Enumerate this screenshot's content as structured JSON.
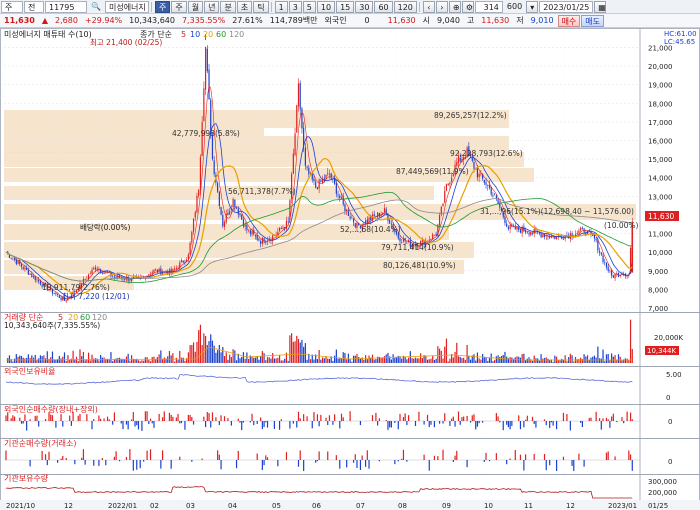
{
  "toolbar_row1": {
    "market_select": "주",
    "period_select": "전",
    "code_input": "11795",
    "stock_name": "미성에너지",
    "period_buttons": [
      "주",
      "주",
      "월",
      "년",
      "분",
      "초",
      "틱"
    ],
    "minute_buttons": [
      "1",
      "3",
      "5",
      "10",
      "15",
      "30",
      "60",
      "120"
    ],
    "count_input": "314",
    "total_count": "600",
    "date_input": "2023/01/25"
  },
  "quote_row": {
    "price": "11,630",
    "change": "2,680",
    "change_pct": "+29.94%",
    "volume": "10,343,640",
    "volume_pct": "7,335.55%",
    "turnover": "27.61%",
    "amount": "114,789백만",
    "ref_label": "외국인",
    "ref_value": "0",
    "last": "11,630",
    "open_label": "시",
    "open": "9,040",
    "high_label": "고",
    "high": "11,630",
    "low_label": "저",
    "low": "9,010",
    "buy_btn": "매수",
    "sell_btn": "매도"
  },
  "price_panel": {
    "title": "미성에너지 매튜태 수(10)",
    "ma_legend": [
      "종가 단순",
      "5",
      "10",
      "20",
      "60",
      "120"
    ],
    "hc_label": "HC:61.00",
    "lc_label": "LC:45.65",
    "current_price_tag": "11,630",
    "y_ticks": [
      "21,000",
      "20,000",
      "19,000",
      "18,000",
      "17,000",
      "16,000",
      "15,000",
      "14,000",
      "13,000",
      "12,000",
      "11,000",
      "10,000",
      "9,000",
      "8,000",
      "7,000"
    ],
    "annotations": {
      "high_mark": "최고 21,400 (02/25)",
      "low_mark": "최저 7,220 (12/01)",
      "vol1": "42,779,998(5.8%)",
      "vol2": "56,711,378(7.7%)",
      "vol3": "89,265,257(12.2%)",
      "vol4": "92,228,793(12.6%)",
      "vol5": "87,449,569(11.9%)",
      "vol6": "31,...,96(15.1%)(12,698,40 ~ 11,576.00)",
      "vol7": "52,...,68(10.4%)",
      "vol8": "79,711,414(10.9%)",
      "vol9": "80,126,481(10.9%)",
      "vol10": "(10.00%)",
      "left_low": "19,911,79(2.76%)",
      "event": "배당락(0.00%)"
    }
  },
  "volume_panel": {
    "title": "거래량 단순",
    "ma_legend": [
      "5",
      "20",
      "60",
      "120"
    ],
    "value_label": "10,343,640주(7,335.55%)",
    "y_tick": "20,000K",
    "current_tag": "10,344K"
  },
  "sub_panels": [
    {
      "title": "외국인보유비율",
      "y_tick": "5.00",
      "zero": "0"
    },
    {
      "title": "외국인순매수량(장내+장외)",
      "zero": "0"
    },
    {
      "title": "기관순매수량(거래소)",
      "zero": "0"
    },
    {
      "title": "기관보유수량",
      "y_ticks": [
        "300,000",
        "200,000"
      ]
    }
  ],
  "x_axis": [
    "2021/10",
    "12",
    "2022/01",
    "02",
    "03",
    "04",
    "05",
    "06",
    "07",
    "08",
    "09",
    "10",
    "11",
    "12",
    "2023/01",
    "01/25"
  ],
  "colors": {
    "candle_up": "#e02020",
    "candle_down": "#1a40d0",
    "ma5": "#e02020",
    "ma10": "#1a40d0",
    "ma20": "#e8a000",
    "ma60": "#1a9a30",
    "ma120": "#8a8a8a",
    "band": "#f6dfc4"
  },
  "chart_data": {
    "type": "candlestick",
    "x_range": [
      "2021/10",
      "2023/01/25"
    ],
    "y_range": [
      7000,
      21400
    ],
    "key_points": [
      {
        "date": "2021/10",
        "close": 10000
      },
      {
        "date": "2021/12/01",
        "low": 7220
      },
      {
        "date": "2022/01",
        "close": 8500
      },
      {
        "date": "2022/02/25",
        "high": 21400
      },
      {
        "date": "2022/03",
        "close": 11500
      },
      {
        "date": "2022/04",
        "close": 10500
      },
      {
        "date": "2022/05",
        "close": 18000
      },
      {
        "date": "2022/06",
        "close": 12000
      },
      {
        "date": "2022/07",
        "close": 10500
      },
      {
        "date": "2022/08",
        "close": 15000
      },
      {
        "date": "2022/09",
        "close": 13500
      },
      {
        "date": "2022/10",
        "close": 11300
      },
      {
        "date": "2022/12",
        "close": 10800
      },
      {
        "date": "2023/01",
        "close": 8700
      },
      {
        "date": "2023/01/25",
        "close": 11630
      }
    ]
  }
}
